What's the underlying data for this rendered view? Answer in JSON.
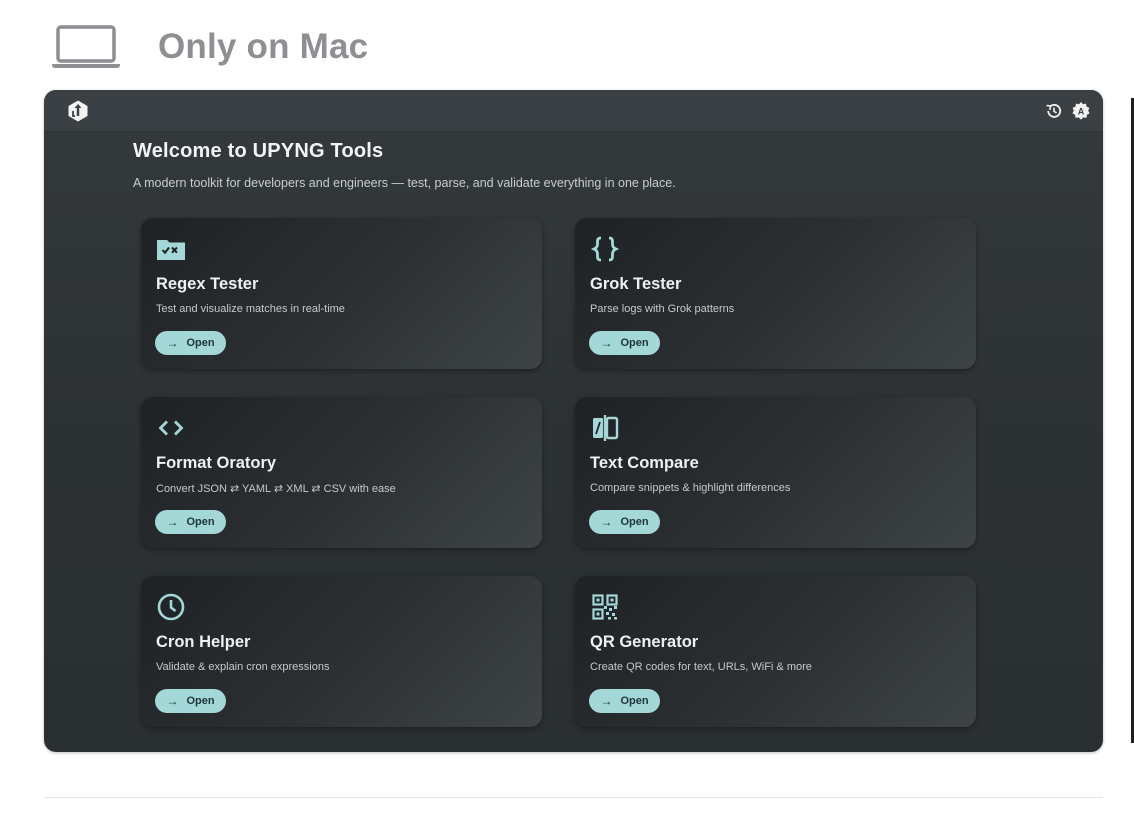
{
  "platform": {
    "label": "Only on Mac",
    "icon": "laptop-icon"
  },
  "app": {
    "titlebar": {
      "logo_icon": "upyng-logo-icon",
      "history_icon": "history-icon",
      "settings_icon": "settings-gear-icon"
    },
    "welcome": {
      "title": "Welcome to UPYNG Tools",
      "subtitle": "A modern toolkit for developers and engineers — test, parse, and validate everything in one place."
    },
    "cards": [
      {
        "title": "Regex Tester",
        "description": "Test and visualize matches in real-time",
        "button": "Open",
        "icon": "regex-folder-icon"
      },
      {
        "title": "Grok Tester",
        "description": "Parse logs with Grok patterns",
        "button": "Open",
        "icon": "braces-icon"
      },
      {
        "title": "Format Oratory",
        "description": "Convert JSON ⇄ YAML ⇄ XML ⇄ CSV with ease",
        "button": "Open",
        "icon": "code-brackets-icon"
      },
      {
        "title": "Text Compare",
        "description": "Compare snippets & highlight differences",
        "button": "Open",
        "icon": "compare-icon"
      },
      {
        "title": "Cron Helper",
        "description": "Validate & explain cron expressions",
        "button": "Open",
        "icon": "clock-icon"
      },
      {
        "title": "QR Generator",
        "description": "Create QR codes for text, URLs, WiFi & more",
        "button": "Open",
        "icon": "qr-code-icon"
      }
    ]
  },
  "colors": {
    "window_bg": "#2c3134",
    "titlebar_bg": "#3a4043",
    "accent": "#a4d8d8",
    "platform_text": "#8e8e93"
  }
}
